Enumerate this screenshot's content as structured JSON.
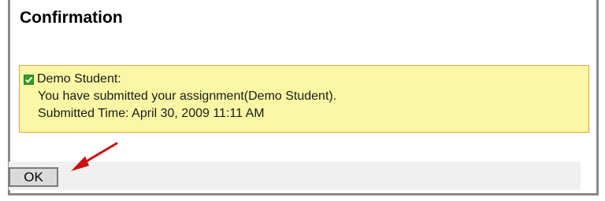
{
  "dialog": {
    "title": "Confirmation"
  },
  "message": {
    "recipient": "Demo Student:",
    "body": "You have submitted your assignment(Demo Student).",
    "submitted_time": "Submitted Time: April 30, 2009 11:11 AM",
    "check_icon": "checkbox-checked-icon"
  },
  "actions": {
    "ok_label": "OK"
  },
  "colors": {
    "message_background": "#fbf8a5",
    "message_border": "#e9a23b",
    "check_green": "#3a9a2a",
    "arrow_red": "#cc1111"
  }
}
